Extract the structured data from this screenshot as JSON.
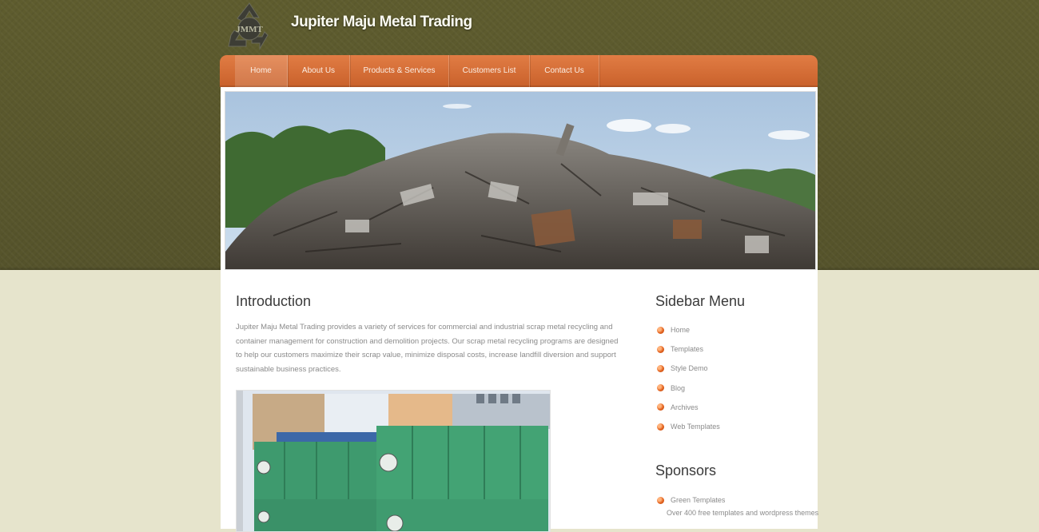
{
  "site": {
    "title": "Jupiter Maju Metal Trading",
    "logo_text": "JMMT"
  },
  "nav": {
    "items": [
      {
        "label": "Home",
        "active": true
      },
      {
        "label": "About Us",
        "active": false
      },
      {
        "label": "Products & Services",
        "active": false
      },
      {
        "label": "Customers List",
        "active": false
      },
      {
        "label": "Contact Us",
        "active": false
      }
    ]
  },
  "main": {
    "heading": "Introduction",
    "intro": "Jupiter Maju Metal Trading provides a variety of services for commercial and industrial scrap metal recycling and container management for construction and demolition projects. Our scrap metal recycling programs are designed to help our customers maximize their scrap value, minimize disposal costs, increase landfill diversion and support sustainable business practices."
  },
  "sidebar": {
    "menu_heading": "Sidebar Menu",
    "menu_items": [
      "Home",
      "Templates",
      "Style Demo",
      "Blog",
      "Archives",
      "Web Templates"
    ],
    "sponsors_heading": "Sponsors",
    "sponsor": {
      "name": "Green Templates",
      "desc": "Over 400 free templates and wordpress themes"
    }
  },
  "colors": {
    "accent": "#d4692f",
    "header_bg": "#5a582d",
    "page_bg": "#e6e4cc"
  }
}
